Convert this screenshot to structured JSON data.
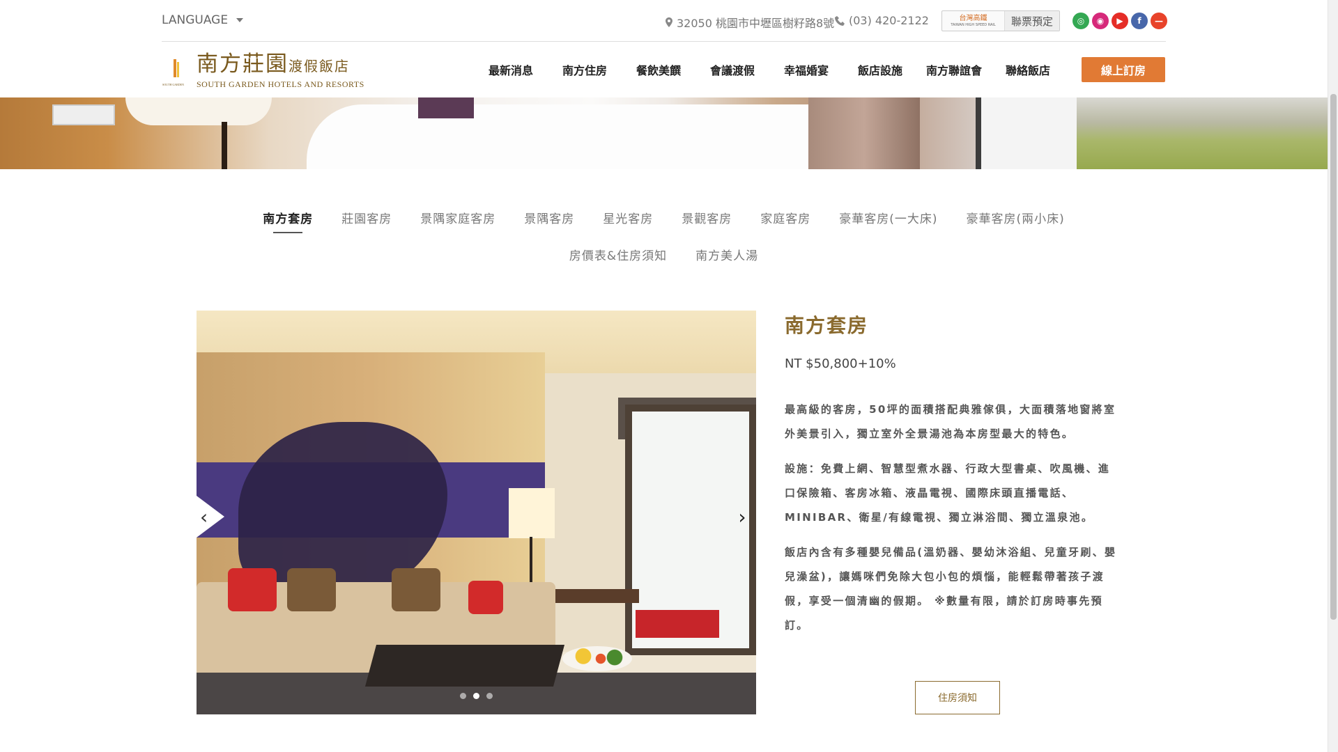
{
  "topbar": {
    "language_label": "LANGUAGE",
    "address": "32050 桃園市中壢區樹籽路8號",
    "phone": "(03) 420-2122",
    "hsr_logo_text": "台灣高鐵",
    "hsr_logo_sub": "TAIWAN HIGH SPEED RAIL",
    "hsr_label": "聯票預定",
    "social_icons": [
      {
        "name": "tripadvisor-icon",
        "color": "#34a853",
        "glyph": "◎"
      },
      {
        "name": "instagram-icon",
        "color": "#d6297a",
        "glyph": "◉"
      },
      {
        "name": "youtube-icon",
        "color": "#e52d27",
        "glyph": "▶"
      },
      {
        "name": "facebook-icon",
        "color": "#4867aa",
        "glyph": "f"
      },
      {
        "name": "line-icon",
        "color": "#e8432a",
        "glyph": "—"
      }
    ]
  },
  "header": {
    "logo_cn": "南方莊園",
    "logo_cn_small": "渡假飯店",
    "logo_en": "SOUTH GARDEN HOTELS AND RESORTS",
    "nav": [
      "最新消息",
      "南方住房",
      "餐飲美饌",
      "會議渡假",
      "幸福婚宴",
      "飯店設施",
      "南方聯誼會",
      "聯絡飯店"
    ],
    "book_label": "線上訂房",
    "accent_color": "#e17a34"
  },
  "tabs": {
    "row1": [
      "南方套房",
      "莊園客房",
      "景隅家庭客房",
      "景隅客房",
      "星光客房",
      "景觀客房",
      "家庭客房",
      "豪華客房(一大床)",
      "豪華客房(兩小床)"
    ],
    "row2": [
      "房價表&住房須知",
      "南方美人湯"
    ],
    "active": "南方套房"
  },
  "room": {
    "title": "南方套房",
    "price": "NT $50,800+10%",
    "desc": [
      "最高級的客房，50坪的面積搭配典雅傢俱，大面積落地窗將室外美景引入，獨立室外全景湯池為本房型最大的特色。",
      "設施：免費上網、智慧型煮水器、行政大型書桌、吹風機、進口保險箱、客房冰箱、液晶電視、國際床頭直播電話、MINIBAR、衛星/有線電視、獨立淋浴間、獨立溫泉池。",
      "飯店內含有多種嬰兒備品(溫奶器、嬰幼沐浴組、兒童牙刷、嬰兒澡盆)，讓媽咪們免除大包小包的煩惱，能輕鬆帶著孩子渡假，享受一個清幽的假期。 ※數量有限，請於訂房時事先預訂。"
    ],
    "notice_label": "住房須知"
  },
  "carousel": {
    "prev_glyph": "‹",
    "next_glyph": "›",
    "slide_count": 3,
    "active_slide": 2
  }
}
